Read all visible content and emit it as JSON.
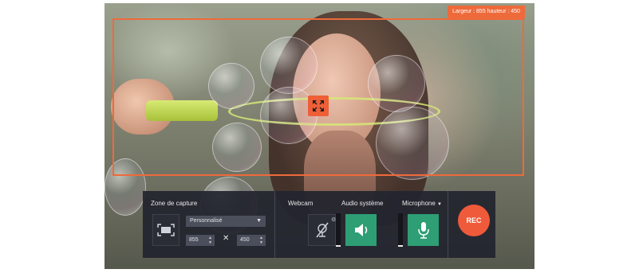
{
  "overlay": {
    "size_label": "Largeur : 855 hauteur : 450"
  },
  "panel": {
    "capture": {
      "title": "Zone de capture",
      "preset": "Personnalisé",
      "width": "855",
      "height": "450",
      "times": "✕"
    },
    "webcam": {
      "title": "Webcam"
    },
    "system_audio": {
      "title": "Audio système",
      "level": 0.05
    },
    "microphone": {
      "title": "Microphone",
      "caret": "▼",
      "level": 0.05
    },
    "rec": {
      "label": "REC"
    }
  },
  "colors": {
    "accent": "#ee6a3b",
    "panel": "#22252e",
    "green": "#2e9e74",
    "rec": "#ef5a3a"
  },
  "icons": [
    "capture-area-icon",
    "move-arrows-icon",
    "webcam-off-icon",
    "gear-icon",
    "speaker-icon",
    "microphone-icon"
  ]
}
